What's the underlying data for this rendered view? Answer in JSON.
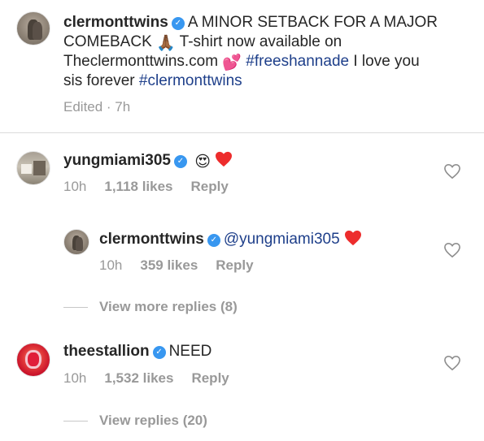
{
  "post": {
    "username": "clermonttwins",
    "caption_line1": "A MINOR SETBACK FOR A MAJOR",
    "caption_line2_text": "COMEBACK",
    "caption_line2_rest": "T-shirt now available on",
    "caption_line3_text": "Theclermonttwins.com",
    "caption_line3_tag": "#freeshannade",
    "caption_line3_rest": "I love you",
    "caption_line4_text": "sis forever",
    "caption_line4_tag": "#clermonttwins",
    "edited": "Edited · 7h",
    "emoji_pray": "🙏🏾",
    "emoji_hearts": "💕"
  },
  "comments": [
    {
      "username": "yungmiami305",
      "emoji_text": "😍",
      "time": "10h",
      "likes": "1,118 likes",
      "reply": "Reply"
    },
    {
      "username": "theestallion",
      "text": "NEED",
      "time": "10h",
      "likes": "1,532 likes",
      "reply": "Reply",
      "view_replies": "View replies (20)"
    }
  ],
  "reply": {
    "username": "clermonttwins",
    "mention": "@yungmiami305",
    "time": "10h",
    "likes": "359 likes",
    "reply": "Reply",
    "view_more": "View more replies (8)"
  },
  "colors": {
    "verified": "#3897f0",
    "hashtag": "#1e3f8a",
    "meta": "#999999",
    "heart_red": "#ed2c2c"
  },
  "icons": {
    "verified": "verified-badge-icon",
    "like": "heart-outline-icon",
    "red_heart": "red-heart-emoji-icon"
  }
}
